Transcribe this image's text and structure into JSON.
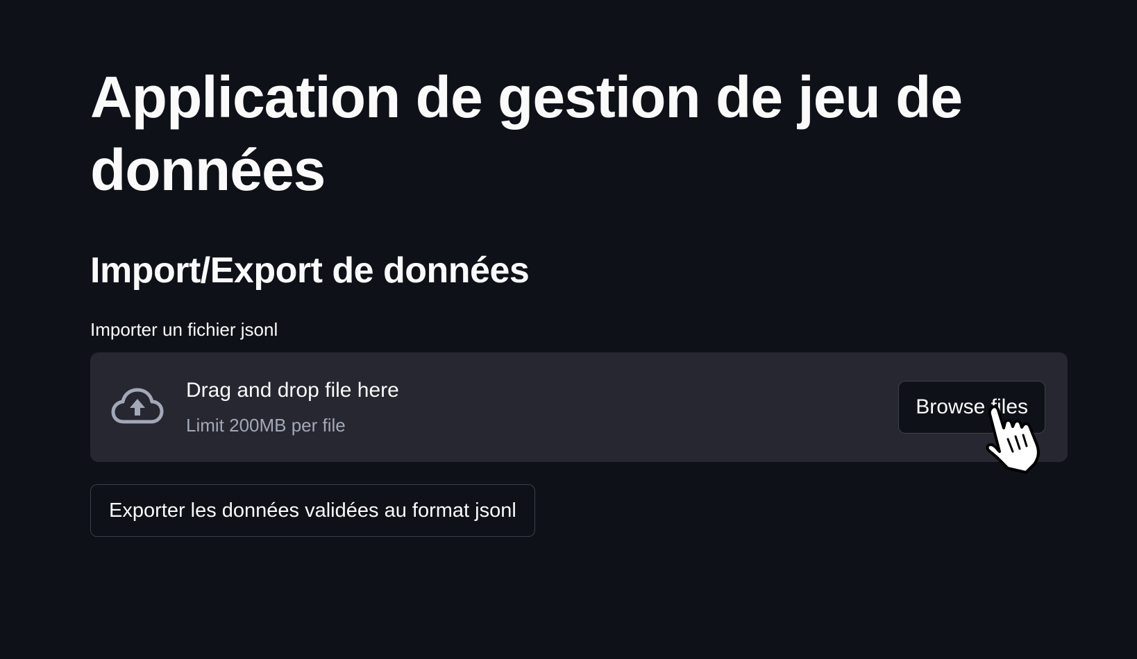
{
  "header": {
    "title": "Application de gestion de jeu de données"
  },
  "section": {
    "title": "Import/Export de données"
  },
  "uploader": {
    "label": "Importer un fichier jsonl",
    "instructions": "Drag and drop file here",
    "limit": "Limit 200MB per file",
    "browse_label": "Browse files",
    "icon": "cloud-upload-icon"
  },
  "export": {
    "button_label": "Exporter les données validées au format jsonl"
  },
  "cursor": {
    "icon": "hand-pointer-icon"
  },
  "colors": {
    "background": "#0e1117",
    "surface": "#262730",
    "text": "#fafafa",
    "muted_text": "#a3a8b8",
    "border": "#3d404a"
  }
}
